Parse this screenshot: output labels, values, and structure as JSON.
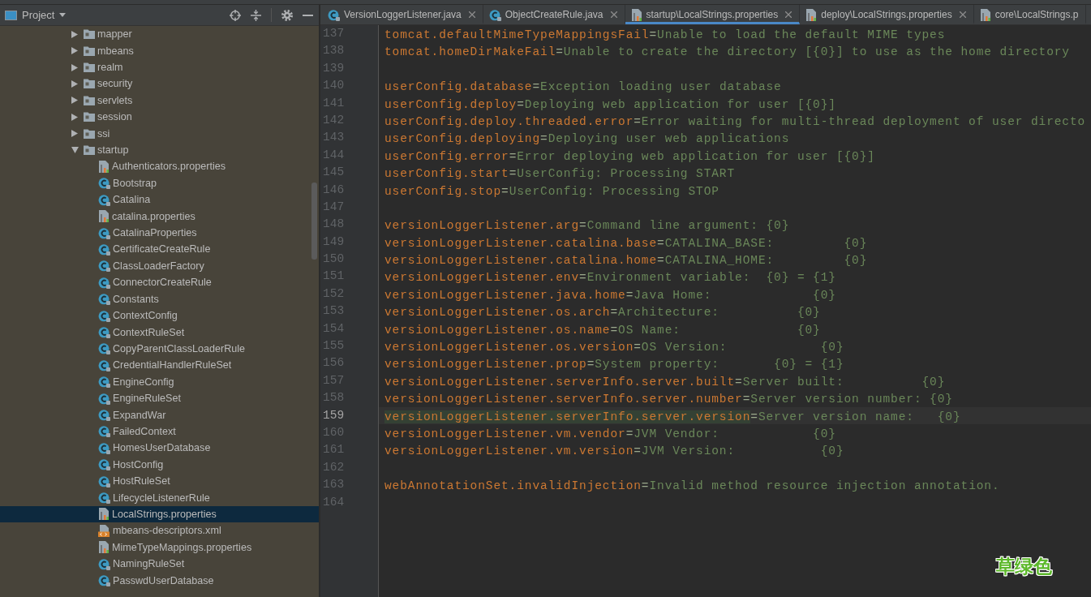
{
  "sidebar": {
    "title": "Project",
    "tree": [
      {
        "label": "mapper",
        "kind": "package",
        "expanded": false,
        "selected": false
      },
      {
        "label": "mbeans",
        "kind": "package",
        "expanded": false,
        "selected": false
      },
      {
        "label": "realm",
        "kind": "package",
        "expanded": false,
        "selected": false
      },
      {
        "label": "security",
        "kind": "package",
        "expanded": false,
        "selected": false
      },
      {
        "label": "servlets",
        "kind": "package",
        "expanded": false,
        "selected": false
      },
      {
        "label": "session",
        "kind": "package",
        "expanded": false,
        "selected": false
      },
      {
        "label": "ssi",
        "kind": "package",
        "expanded": false,
        "selected": false
      },
      {
        "label": "startup",
        "kind": "package",
        "expanded": true,
        "selected": false,
        "children": [
          {
            "label": "Authenticators.properties",
            "kind": "properties",
            "selected": false
          },
          {
            "label": "Bootstrap",
            "kind": "main_class",
            "selected": false
          },
          {
            "label": "Catalina",
            "kind": "class",
            "selected": false
          },
          {
            "label": "catalina.properties",
            "kind": "properties",
            "selected": false
          },
          {
            "label": "CatalinaProperties",
            "kind": "class",
            "selected": false
          },
          {
            "label": "CertificateCreateRule",
            "kind": "class",
            "selected": false
          },
          {
            "label": "ClassLoaderFactory",
            "kind": "final_class",
            "selected": false
          },
          {
            "label": "ConnectorCreateRule",
            "kind": "class",
            "selected": false
          },
          {
            "label": "Constants",
            "kind": "final_class",
            "selected": false
          },
          {
            "label": "ContextConfig",
            "kind": "class",
            "selected": false
          },
          {
            "label": "ContextRuleSet",
            "kind": "class",
            "selected": false
          },
          {
            "label": "CopyParentClassLoaderRule",
            "kind": "class",
            "selected": false
          },
          {
            "label": "CredentialHandlerRuleSet",
            "kind": "class",
            "selected": false
          },
          {
            "label": "EngineConfig",
            "kind": "class",
            "selected": false
          },
          {
            "label": "EngineRuleSet",
            "kind": "class",
            "selected": false
          },
          {
            "label": "ExpandWar",
            "kind": "class",
            "selected": false
          },
          {
            "label": "FailedContext",
            "kind": "class",
            "selected": false
          },
          {
            "label": "HomesUserDatabase",
            "kind": "final_class",
            "selected": false
          },
          {
            "label": "HostConfig",
            "kind": "class",
            "selected": false
          },
          {
            "label": "HostRuleSet",
            "kind": "class",
            "selected": false
          },
          {
            "label": "LifecycleListenerRule",
            "kind": "class",
            "selected": false
          },
          {
            "label": "LocalStrings.properties",
            "kind": "properties",
            "selected": true
          },
          {
            "label": "mbeans-descriptors.xml",
            "kind": "xml",
            "selected": false
          },
          {
            "label": "MimeTypeMappings.properties",
            "kind": "properties",
            "selected": false
          },
          {
            "label": "NamingRuleSet",
            "kind": "class",
            "selected": false
          },
          {
            "label": "PasswdUserDatabase",
            "kind": "final_class",
            "selected": false
          }
        ]
      }
    ]
  },
  "editor": {
    "tabs": [
      {
        "label": "VersionLoggerListener.java",
        "kind": "class",
        "selected": false,
        "closable": true
      },
      {
        "label": "ObjectCreateRule.java",
        "kind": "class",
        "selected": false,
        "closable": true
      },
      {
        "label": "startup\\LocalStrings.properties",
        "kind": "properties",
        "selected": true,
        "closable": true
      },
      {
        "label": "deploy\\LocalStrings.properties",
        "kind": "properties",
        "selected": false,
        "closable": true
      },
      {
        "label": "core\\LocalStrings.p",
        "kind": "properties",
        "selected": false,
        "closable": false
      }
    ],
    "lines": [
      {
        "number": "137",
        "key": "tomcat.defaultMimeTypeMappingsFail",
        "separator": "=",
        "value": "Unable to load the default MIME types",
        "current": false
      },
      {
        "number": "138",
        "key": "tomcat.homeDirMakeFail",
        "separator": "=",
        "value": "Unable to create the directory [{0}] to use as the home directory",
        "current": false
      },
      {
        "number": "139",
        "current": false
      },
      {
        "number": "140",
        "key": "userConfig.database",
        "separator": "=",
        "value": "Exception loading user database",
        "current": false
      },
      {
        "number": "141",
        "key": "userConfig.deploy",
        "separator": "=",
        "value": "Deploying web application for user [{0}]",
        "current": false
      },
      {
        "number": "142",
        "key": "userConfig.deploy.threaded.error",
        "separator": "=",
        "value": "Error waiting for multi-thread deployment of user directo",
        "current": false
      },
      {
        "number": "143",
        "key": "userConfig.deploying",
        "separator": "=",
        "value": "Deploying user web applications",
        "current": false
      },
      {
        "number": "144",
        "key": "userConfig.error",
        "separator": "=",
        "value": "Error deploying web application for user [{0}]",
        "current": false
      },
      {
        "number": "145",
        "key": "userConfig.start",
        "separator": "=",
        "value": "UserConfig: Processing START",
        "current": false
      },
      {
        "number": "146",
        "key": "userConfig.stop",
        "separator": "=",
        "value": "UserConfig: Processing STOP",
        "current": false
      },
      {
        "number": "147",
        "current": false
      },
      {
        "number": "148",
        "key": "versionLoggerListener.arg",
        "separator": "=",
        "value": "Command line argument: {0}",
        "current": false
      },
      {
        "number": "149",
        "key": "versionLoggerListener.catalina.base",
        "separator": "=",
        "value": "CATALINA_BASE:         {0}",
        "current": false
      },
      {
        "number": "150",
        "key": "versionLoggerListener.catalina.home",
        "separator": "=",
        "value": "CATALINA_HOME:         {0}",
        "current": false
      },
      {
        "number": "151",
        "key": "versionLoggerListener.env",
        "separator": "=",
        "value": "Environment variable:  {0} = {1}",
        "current": false
      },
      {
        "number": "152",
        "key": "versionLoggerListener.java.home",
        "separator": "=",
        "value": "Java Home:             {0}",
        "current": false
      },
      {
        "number": "153",
        "key": "versionLoggerListener.os.arch",
        "separator": "=",
        "value": "Architecture:          {0}",
        "current": false
      },
      {
        "number": "154",
        "key": "versionLoggerListener.os.name",
        "separator": "=",
        "value": "OS Name:               {0}",
        "current": false
      },
      {
        "number": "155",
        "key": "versionLoggerListener.os.version",
        "separator": "=",
        "value": "OS Version:            {0}",
        "current": false
      },
      {
        "number": "156",
        "key": "versionLoggerListener.prop",
        "separator": "=",
        "value": "System property:       {0} = {1}",
        "current": false
      },
      {
        "number": "157",
        "key": "versionLoggerListener.serverInfo.server.built",
        "separator": "=",
        "value": "Server built:          {0}",
        "current": false
      },
      {
        "number": "158",
        "key": "versionLoggerListener.serverInfo.server.number",
        "separator": "=",
        "value": "Server version number: {0}",
        "current": false
      },
      {
        "number": "159",
        "key": "versionLoggerListener.serverInfo.server.version",
        "separator": "=",
        "value": "Server version name:   {0}",
        "current": true
      },
      {
        "number": "160",
        "key": "versionLoggerListener.vm.vendor",
        "separator": "=",
        "value": "JVM Vendor:            {0}",
        "current": false
      },
      {
        "number": "161",
        "key": "versionLoggerListener.vm.version",
        "separator": "=",
        "value": "JVM Version:           {0}",
        "current": false
      },
      {
        "number": "162",
        "current": false
      },
      {
        "number": "163",
        "key": "webAnnotationSet.invalidInjection",
        "separator": "=",
        "value": "Invalid method resource injection annotation.",
        "current": false
      },
      {
        "number": "164",
        "current": false
      }
    ]
  },
  "annotation": "草绿色"
}
